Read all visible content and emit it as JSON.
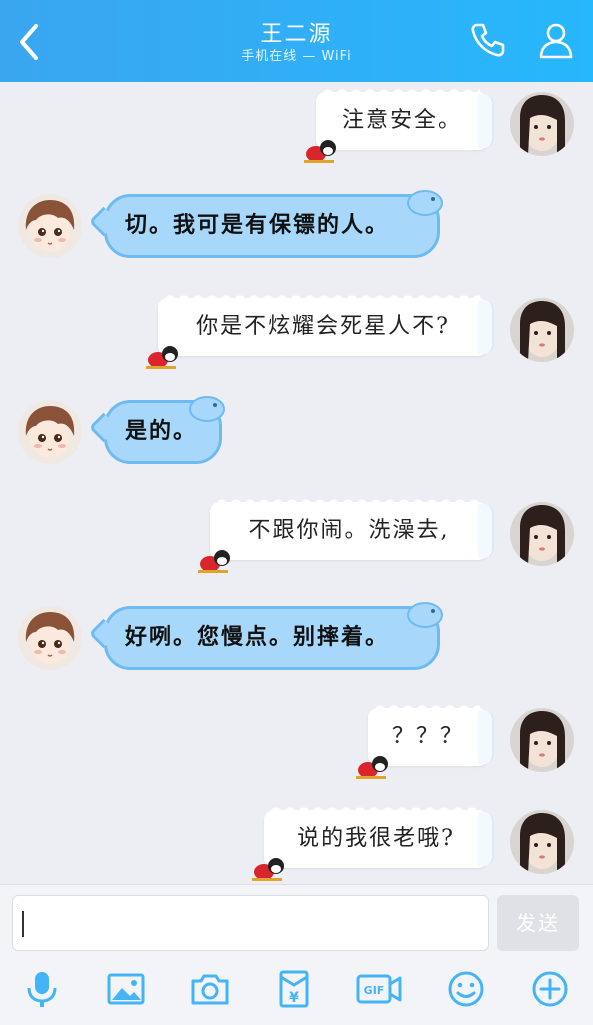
{
  "header": {
    "title": "王二源",
    "subtitle": "手机在线 — WiFi"
  },
  "messages": [
    {
      "side": "right",
      "text": "注意安全。"
    },
    {
      "side": "left",
      "text": "切。我可是有保镖的人。"
    },
    {
      "side": "right",
      "text": "你是不炫耀会死星人不?"
    },
    {
      "side": "left",
      "text": "是的。"
    },
    {
      "side": "right",
      "text": "不跟你闹。洗澡去,"
    },
    {
      "side": "left",
      "text": "好咧。您慢点。别摔着。"
    },
    {
      "side": "right",
      "text": "？？？"
    },
    {
      "side": "right",
      "text": "说的我很老哦?"
    }
  ],
  "composer": {
    "input_value": "",
    "send_label": "发送"
  },
  "toolbar": {
    "icons": [
      "microphone-icon",
      "image-icon",
      "camera-icon",
      "red-packet-icon",
      "gif-icon",
      "emoji-icon",
      "plus-icon"
    ],
    "gif_label": "GIF"
  },
  "colors": {
    "header": "#2aaef5",
    "left_bubble": "#a7d8fb",
    "left_bubble_border": "#6fbaf0",
    "right_bubble": "#ffffff",
    "icon_blue": "#45b4f7"
  }
}
